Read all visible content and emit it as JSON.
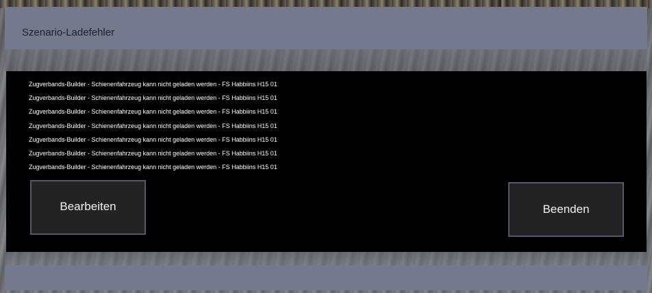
{
  "dialog": {
    "title": "Szenario-Ladefehler"
  },
  "errors": [
    "Zugverbands-Builder - Schienenfahrzeug kann nicht geladen werden - FS Habbiins H15 01",
    "Zugverbands-Builder - Schienenfahrzeug kann nicht geladen werden - FS Habbiins H15 01",
    "Zugverbands-Builder - Schienenfahrzeug kann nicht geladen werden - FS Habbiins H15 01",
    "Zugverbands-Builder - Schienenfahrzeug kann nicht geladen werden - FS Habbiins H15 01",
    "Zugverbands-Builder - Schienenfahrzeug kann nicht geladen werden - FS Habbiins H15 01",
    "Zugverbands-Builder - Schienenfahrzeug kann nicht geladen werden - FS Habbiins H15 01",
    "Zugverbands-Builder - Schienenfahrzeug kann nicht geladen werden - FS Habbiins H15 01"
  ],
  "buttons": {
    "edit_label": "Bearbeiten",
    "quit_label": "Beenden"
  },
  "colors": {
    "panel": "#737a8e",
    "log_background": "#000000",
    "button_background": "#232323",
    "button_border": "#55596a"
  }
}
